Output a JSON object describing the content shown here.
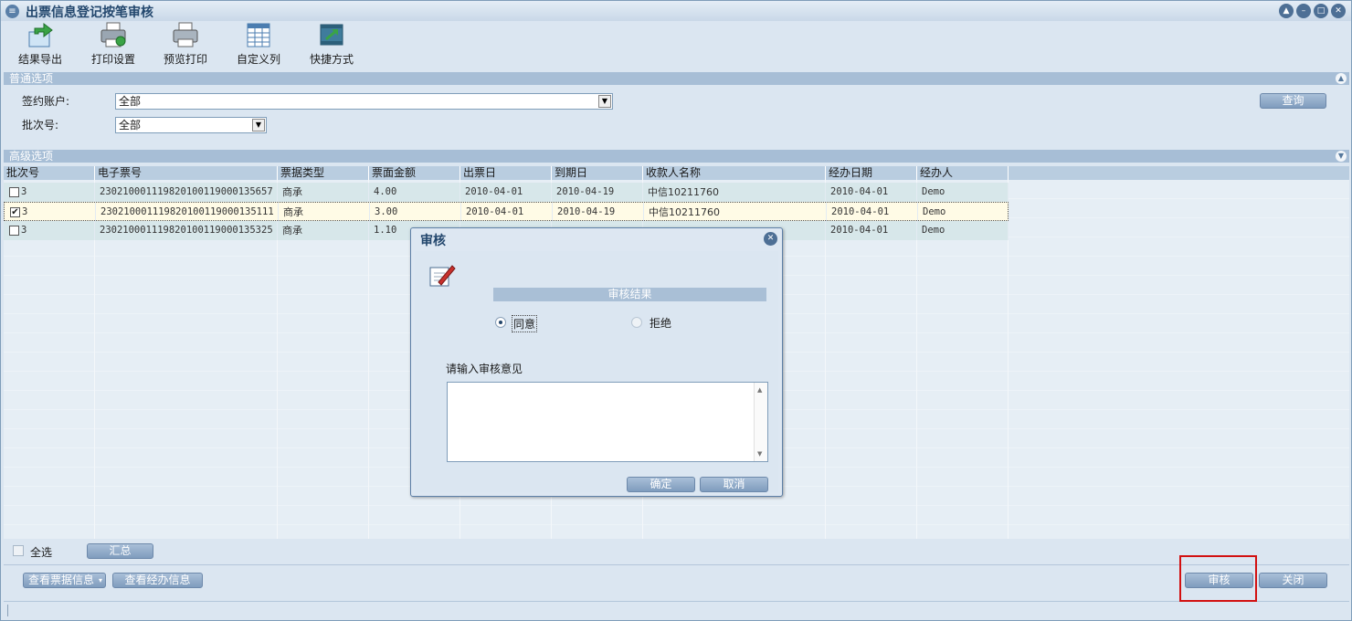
{
  "window": {
    "title": "出票信息登记按笔审核",
    "controls": [
      "help",
      "minimize",
      "maximize",
      "close"
    ]
  },
  "toolbar": {
    "items": [
      {
        "label": "结果导出",
        "icon": "export-icon"
      },
      {
        "label": "打印设置",
        "icon": "print-settings-icon"
      },
      {
        "label": "预览打印",
        "icon": "print-preview-icon"
      },
      {
        "label": "自定义列",
        "icon": "custom-columns-icon"
      },
      {
        "label": "快捷方式",
        "icon": "shortcut-icon"
      }
    ]
  },
  "normal_options": {
    "title": "普通选项",
    "account_label": "签约账户:",
    "account_value": "全部",
    "batch_label": "批次号:",
    "batch_value": "全部",
    "query_label": "查询"
  },
  "advanced_options": {
    "title": "高级选项"
  },
  "grid": {
    "columns": [
      "批次号",
      "电子票号",
      "票据类型",
      "票面金额",
      "出票日",
      "到期日",
      "收款人名称",
      "经办日期",
      "经办人"
    ],
    "rows": [
      {
        "checked": false,
        "batch": "3",
        "ticket_no": "230210001119820100119000135657",
        "type": "商承",
        "amount": "4.00",
        "issue_date": "2010-04-01",
        "due_date": "2010-04-19",
        "payee": "中信10211760",
        "handle_date": "2010-04-01",
        "handler": "Demo"
      },
      {
        "checked": true,
        "batch": "3",
        "ticket_no": "230210001119820100119000135111",
        "type": "商承",
        "amount": "3.00",
        "issue_date": "2010-04-01",
        "due_date": "2010-04-19",
        "payee": "中信10211760",
        "handle_date": "2010-04-01",
        "handler": "Demo"
      },
      {
        "checked": false,
        "batch": "3",
        "ticket_no": "230210001119820100119000135325",
        "type": "商承",
        "amount": "1.10",
        "issue_date": "",
        "due_date": "",
        "payee": "",
        "handle_date": "2010-04-01",
        "handler": "Demo"
      }
    ]
  },
  "footer": {
    "select_all_label": "全选",
    "summary_label": "汇总",
    "view_ticket_label": "查看票据信息",
    "view_handle_label": "查看经办信息",
    "audit_label": "审核",
    "close_label": "关闭"
  },
  "dialog": {
    "title": "审核",
    "result_title": "审核结果",
    "agree_label": "同意",
    "reject_label": "拒绝",
    "selected": "agree",
    "opinion_label": "请输入审核意见",
    "opinion_value": "",
    "confirm_label": "确定",
    "cancel_label": "取消"
  }
}
